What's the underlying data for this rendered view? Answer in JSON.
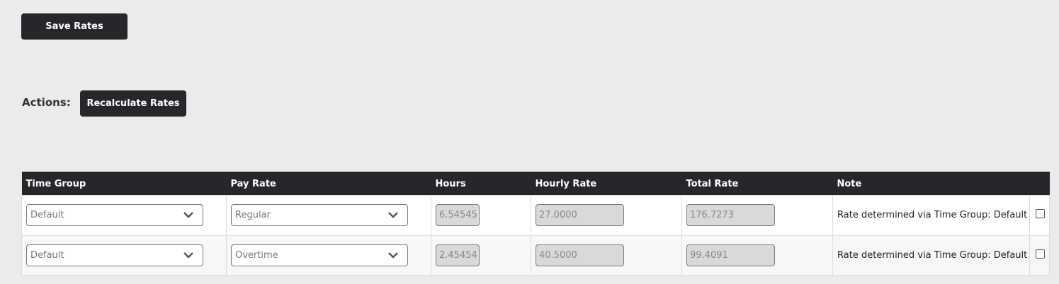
{
  "buttons": {
    "save": "Save Rates",
    "recalculate": "Recalculate Rates"
  },
  "actions_label": "Actions:",
  "table": {
    "headers": [
      "Time Group",
      "Pay Rate",
      "Hours",
      "Hourly Rate",
      "Total Rate",
      "Note",
      ""
    ],
    "rows": [
      {
        "time_group": "Default",
        "pay_rate": "Regular",
        "hours": "6.54545",
        "hourly_rate": "27.0000",
        "total_rate": "176.7273",
        "note": "Rate determined via Time Group: Default"
      },
      {
        "time_group": "Default",
        "pay_rate": "Overtime",
        "hours": "2.45454",
        "hourly_rate": "40.5000",
        "total_rate": "99.4091",
        "note": "Rate determined via Time Group: Default"
      }
    ]
  },
  "icons": {
    "dropdown": "chevron-down-icon"
  }
}
